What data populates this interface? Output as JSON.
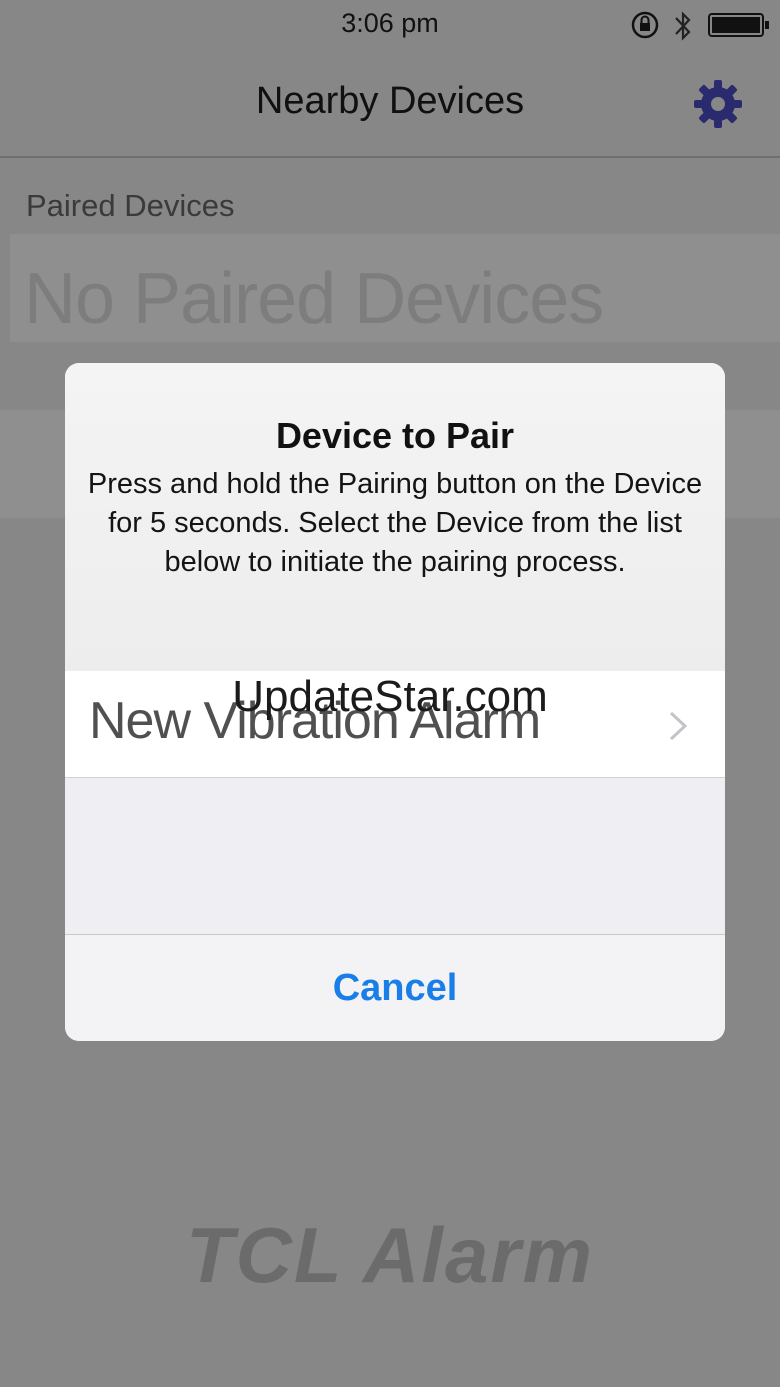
{
  "status_bar": {
    "time": "3:06 pm",
    "icons": [
      "orientation-lock-icon",
      "bluetooth-icon",
      "battery-icon"
    ]
  },
  "nav": {
    "title": "Nearby Devices",
    "settings_icon": "gear-icon",
    "accent_color": "#2a2a6e"
  },
  "paired_section": {
    "header": "Paired Devices",
    "empty_text": "No Paired Devices"
  },
  "dialog": {
    "title": "Device to Pair",
    "message": "Press and hold the Pairing button on the Device for 5 seconds. Select the Device from the list below to initiate the pairing process.",
    "devices": [
      {
        "name": "New Vibration Alarm",
        "icon": "chevron-right-icon"
      }
    ],
    "cancel_label": "Cancel",
    "cancel_color": "#1a7ee8"
  },
  "watermark": "UpdateStar.com",
  "logo_text": "TCL Alarm"
}
